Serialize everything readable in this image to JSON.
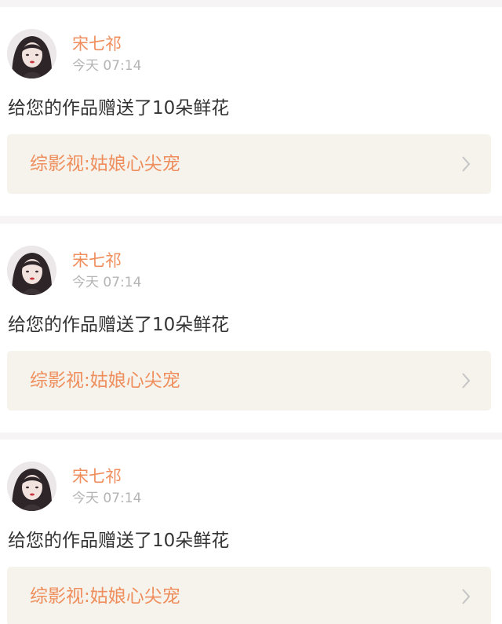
{
  "colors": {
    "accent": "#ef8e5c",
    "secondary_text": "#b4b4b4",
    "primary_text": "#333333",
    "link_background": "#f5f3ec",
    "separator": "#f6f4f4"
  },
  "notifications": [
    {
      "user_name": "宋七祁",
      "time": "今天 07:14",
      "message": "给您的作品赠送了10朵鲜花",
      "work_title": "综影视:姑娘心尖宠",
      "avatar_icon": "user-avatar-photo",
      "arrow_icon": "chevron-right-icon"
    },
    {
      "user_name": "宋七祁",
      "time": "今天 07:14",
      "message": "给您的作品赠送了10朵鲜花",
      "work_title": "综影视:姑娘心尖宠",
      "avatar_icon": "user-avatar-photo",
      "arrow_icon": "chevron-right-icon"
    },
    {
      "user_name": "宋七祁",
      "time": "今天 07:14",
      "message": "给您的作品赠送了10朵鲜花",
      "work_title": "综影视:姑娘心尖宠",
      "avatar_icon": "user-avatar-photo",
      "arrow_icon": "chevron-right-icon"
    }
  ]
}
